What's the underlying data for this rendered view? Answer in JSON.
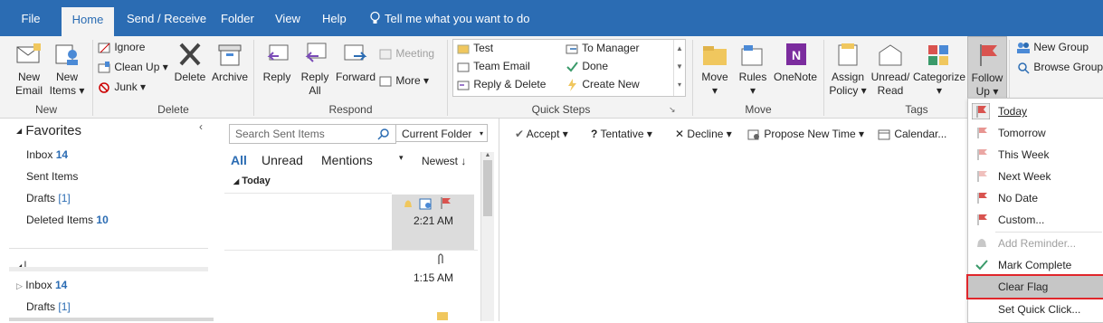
{
  "tabs": [
    {
      "label": "File",
      "active": false
    },
    {
      "label": "Home",
      "active": true
    },
    {
      "label": "Send / Receive",
      "active": false
    },
    {
      "label": "Folder",
      "active": false
    },
    {
      "label": "View",
      "active": false
    },
    {
      "label": "Help",
      "active": false
    }
  ],
  "tell_me": "Tell me what you want to do",
  "ribbon": {
    "new": {
      "new_email_1": "New",
      "new_email_2": "Email",
      "new_items_1": "New",
      "new_items_2": "Items",
      "group": "New"
    },
    "delete": {
      "ignore": "Ignore",
      "clean_up": "Clean Up",
      "junk": "Junk",
      "delete": "Delete",
      "archive": "Archive",
      "group": "Delete"
    },
    "respond": {
      "reply": "Reply",
      "reply_all_1": "Reply",
      "reply_all_2": "All",
      "forward": "Forward",
      "meeting": "Meeting",
      "more": "More",
      "group": "Respond"
    },
    "quick_steps": {
      "items": [
        "Test",
        "Team Email",
        "Reply & Delete",
        "To Manager",
        "Done",
        "Create New"
      ],
      "group": "Quick Steps"
    },
    "move": {
      "move": "Move",
      "rules": "Rules",
      "onenote": "OneNote",
      "group": "Move"
    },
    "tags": {
      "assign_1": "Assign",
      "assign_2": "Policy",
      "unread_1": "Unread/",
      "unread_2": "Read",
      "categorize": "Categorize",
      "follow_1": "Follow",
      "follow_2": "Up",
      "group": "Tags"
    },
    "find": {
      "new_group": "New Group",
      "browse_groups": "Browse Groups"
    }
  },
  "folders": {
    "favorites_title": "Favorites",
    "items": [
      {
        "name": "Inbox",
        "count": "14"
      },
      {
        "name": "Sent Items",
        "count": ""
      },
      {
        "name": "Drafts",
        "count": "[1]"
      },
      {
        "name": "Deleted Items",
        "count": "10"
      }
    ],
    "account_items": [
      {
        "name": "Inbox",
        "count": "14"
      },
      {
        "name": "Drafts",
        "count": "[1]"
      }
    ]
  },
  "message_list": {
    "search_placeholder": "Search Sent Items",
    "scope": "Current Folder",
    "filters": [
      "All",
      "Unread",
      "Mentions"
    ],
    "sort": "Newest",
    "group_header": "Today",
    "times": [
      "2:21 AM",
      "1:15 AM"
    ]
  },
  "reading_toolbar": {
    "accept": "Accept",
    "tentative": "Tentative",
    "decline": "Decline",
    "propose": "Propose New Time",
    "calendar": "Calendar..."
  },
  "followup_menu": [
    {
      "label": "Today",
      "disabled": false
    },
    {
      "label": "Tomorrow",
      "disabled": false
    },
    {
      "label": "This Week",
      "disabled": false
    },
    {
      "label": "Next Week",
      "disabled": false
    },
    {
      "label": "No Date",
      "disabled": false
    },
    {
      "label": "Custom...",
      "disabled": false
    },
    {
      "label": "Add Reminder...",
      "disabled": true
    },
    {
      "label": "Mark Complete",
      "disabled": false
    },
    {
      "label": "Clear Flag",
      "disabled": false
    },
    {
      "label": "Set Quick Click...",
      "disabled": false
    }
  ],
  "colors": {
    "accent": "#2b6cb3",
    "flag": "#d9534f",
    "highlight": "#e0262b",
    "onenote": "#7b2c9e"
  }
}
